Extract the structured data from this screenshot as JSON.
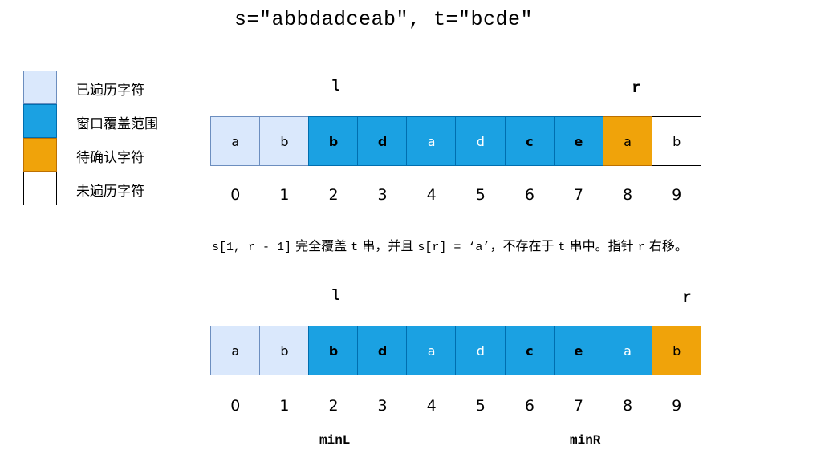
{
  "title": "s=\"abbdadceab\", t=\"bcde\"",
  "legend": [
    {
      "label": "已遍历字符",
      "color": "#dae8fc"
    },
    {
      "label": "窗口覆盖范围",
      "color": "#1ba1e2"
    },
    {
      "label": "待确认字符",
      "color": "#f0a30a"
    },
    {
      "label": "未遍历字符",
      "color": "#ffffff"
    }
  ],
  "colors": {
    "visited": "#dae8fc",
    "window": "#1ba1e2",
    "pending": "#f0a30a",
    "unvisited": "#ffffff",
    "visited_border": "#6c8ebf",
    "window_border": "#006eaf",
    "pending_border": "#bd7000",
    "unvisited_border": "#000000"
  },
  "diagram1": {
    "pointers": {
      "l": "l",
      "r": "r"
    },
    "l_index": 2,
    "r_index": 8,
    "cells": [
      {
        "char": "a",
        "state": "visited"
      },
      {
        "char": "b",
        "state": "visited"
      },
      {
        "char": "b",
        "state": "window",
        "bold": true
      },
      {
        "char": "d",
        "state": "window",
        "bold": true
      },
      {
        "char": "a",
        "state": "window"
      },
      {
        "char": "d",
        "state": "window"
      },
      {
        "char": "c",
        "state": "window",
        "bold": true
      },
      {
        "char": "e",
        "state": "window",
        "bold": true
      },
      {
        "char": "a",
        "state": "pending"
      },
      {
        "char": "b",
        "state": "unvisited"
      }
    ],
    "indices": [
      "0",
      "1",
      "2",
      "3",
      "4",
      "5",
      "6",
      "7",
      "8",
      "9"
    ]
  },
  "description": {
    "part1_mono": "s[1, r - 1]",
    "part2": " 完全覆盖 ",
    "part3_mono": "t",
    "part4": " 串，并且 ",
    "part5_mono": "s[r] = ‘a’",
    "part6": "，不存在于 ",
    "part7_mono": "t",
    "part8": " 串中。指针 ",
    "part9_mono": "r",
    "part10": " 右移。"
  },
  "diagram2": {
    "pointers": {
      "l": "l",
      "r": "r"
    },
    "l_index": 2,
    "r_index": 9,
    "cells": [
      {
        "char": "a",
        "state": "visited"
      },
      {
        "char": "b",
        "state": "visited"
      },
      {
        "char": "b",
        "state": "window",
        "bold": true
      },
      {
        "char": "d",
        "state": "window",
        "bold": true
      },
      {
        "char": "a",
        "state": "window"
      },
      {
        "char": "d",
        "state": "window"
      },
      {
        "char": "c",
        "state": "window",
        "bold": true
      },
      {
        "char": "e",
        "state": "window",
        "bold": true
      },
      {
        "char": "a",
        "state": "window"
      },
      {
        "char": "b",
        "state": "pending"
      }
    ],
    "indices": [
      "0",
      "1",
      "2",
      "3",
      "4",
      "5",
      "6",
      "7",
      "8",
      "9"
    ],
    "min_labels": {
      "minL": "minL",
      "minR": "minR"
    }
  }
}
